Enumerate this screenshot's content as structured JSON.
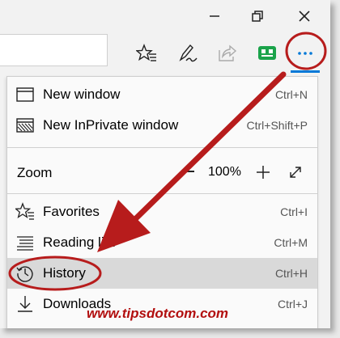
{
  "menu": {
    "items": [
      {
        "label": "New window",
        "shortcut": "Ctrl+N",
        "icon": "window-icon"
      },
      {
        "label": "New InPrivate window",
        "shortcut": "Ctrl+Shift+P",
        "icon": "inprivate-icon"
      },
      {
        "label": "Favorites",
        "shortcut": "Ctrl+I",
        "icon": "favorites-icon"
      },
      {
        "label": "Reading list",
        "shortcut": "Ctrl+M",
        "icon": "reading-list-icon"
      },
      {
        "label": "History",
        "shortcut": "Ctrl+H",
        "icon": "history-icon"
      },
      {
        "label": "Downloads",
        "shortcut": "Ctrl+J",
        "icon": "download-icon"
      }
    ],
    "zoom": {
      "label": "Zoom",
      "value": "100%"
    }
  },
  "toolbar": {
    "icons": [
      "favorites-hub-icon",
      "web-note-pen-icon",
      "share-icon",
      "extension-icon",
      "more-actions-icon"
    ]
  },
  "watermark": "www.tipsdotcom.com",
  "colors": {
    "annotation_red": "#b71c1c",
    "accent_blue": "#0078d7",
    "highlight": "#d9d9d9",
    "extension_green": "#16a34a"
  }
}
